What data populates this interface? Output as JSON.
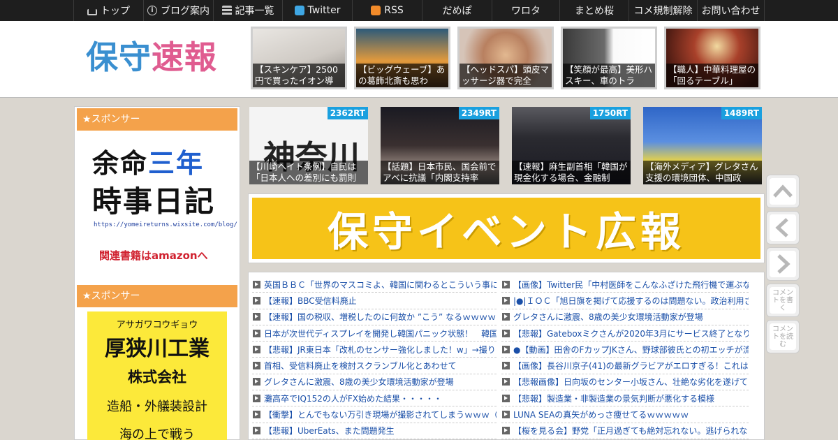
{
  "nav": {
    "items": [
      {
        "label": "トップ",
        "icon": "home-icon"
      },
      {
        "label": "ブログ案内",
        "icon": "info-icon"
      },
      {
        "label": "記事一覧",
        "icon": "list-icon"
      },
      {
        "label": "Twitter",
        "icon": "twitter-icon"
      },
      {
        "label": "RSS",
        "icon": "rss-icon"
      },
      {
        "label": "だめぽ",
        "icon": ""
      },
      {
        "label": "ワロタ",
        "icon": ""
      },
      {
        "label": "まとめ桜",
        "icon": ""
      },
      {
        "label": "コメ規制解除",
        "icon": ""
      },
      {
        "label": "お問い合わせ",
        "icon": ""
      }
    ]
  },
  "header": {
    "logo": "保守速報",
    "thumbs": [
      {
        "caption": "【スキンケア】2500円で買ったイオン導"
      },
      {
        "caption": "【ビッグウェーブ】あの葛飾北斎も思わ"
      },
      {
        "caption": "【ヘッドスパ】頭皮マッサージ器で完全"
      },
      {
        "caption": "【笑顔が最高】美形ハスキー、車のトラ"
      },
      {
        "caption": "【職人】中華料理屋の「回るテーブル」"
      }
    ]
  },
  "sidebar": {
    "sponsor_label": "★スポンサー",
    "ad1": {
      "line1a": "余命",
      "line1b": "三年",
      "line2": "時事日記",
      "url": "https://yomeireturns.wixsite.com/blog/",
      "link": "関連書籍はamazonへ"
    },
    "ad2": {
      "kana": "アサガワコウギョウ",
      "name": "厚狭川工業",
      "corp": "株式会社",
      "desc": "造船・外艤装設計",
      "more": "海の上で戦う"
    }
  },
  "rt_items": [
    {
      "badge": "2362RT",
      "caption": "【川崎ヘイト条例】自民は「日本人への差別にも罰則"
    },
    {
      "badge": "2349RT",
      "caption": "【話題】日本市民、国会前でアベに抗議「内閣支持率"
    },
    {
      "badge": "1750RT",
      "caption": "【速報】麻生副首相「韓国が現金化する場合、金融制"
    },
    {
      "badge": "1489RT",
      "caption": "【海外メディア】グレタさん支援の環境団体、中国政"
    }
  ],
  "banner": {
    "text": "保守イベント広報"
  },
  "list_left": [
    "英国ＢＢＣ「世界のマスコミよ、韓国に関わるとこういう事に",
    "【速報】BBC受信料廃止",
    "【速報】国の税収、増税したのに何故か ”こう” なるｗｗｗｗｗ",
    "日本が次世代ディスプレイを開発し韓国パニック状態！　韓国",
    "【悲報】JR東日本「改札のセンサー強化しました！w」→撮り",
    "首相、受信料廃止を検討スクランブル化とあわせて",
    "グレタさんに激震、8歳の美少女環境活動家が登場",
    "灘高卒でIQ152の人がFX始めた結果・・・・・",
    "【衝撃】とんでもない万引き現場が撮影されてしまうｗｗｗ（",
    "【悲報】UberEats、また問題発生"
  ],
  "list_right": [
    "【画像】Twitter民「中村医師をこんなふざけた飛行機で運ぶな",
    "|●|ＩＯＣ「旭日旗を掲げて応援するのは問題ない。政治利用さ",
    "グレタさんに激震、8歳の美少女環境活動家が登場",
    "【悲報】Gateboxミクさんが2020年3月にサービス終了となり召",
    "●【動画】田舎のFカップJKさん、野球部彼氏との初エッチが流",
    "【画像】長谷川京子(41)の最新グラビアがエロすぎる！これはも",
    "【悲報画像】日向坂のセンター小坂さん、壮絶な劣化を遂げて",
    "【悲報】製造業・非製造業の景気判断が悪化する模様",
    "LUNA SEAの真矢がめっさ痩せてるｗｗｗｗｗ",
    "【桜を見る会】野党「正月過ぎても絶対忘れない。逃げられな"
  ],
  "float_buttons": {
    "top": "top-arrow-icon",
    "prev": "prev-arrow-icon",
    "next": "next-arrow-icon",
    "write_comment": "コメントを書く",
    "read_comment": "コメントを読む"
  }
}
